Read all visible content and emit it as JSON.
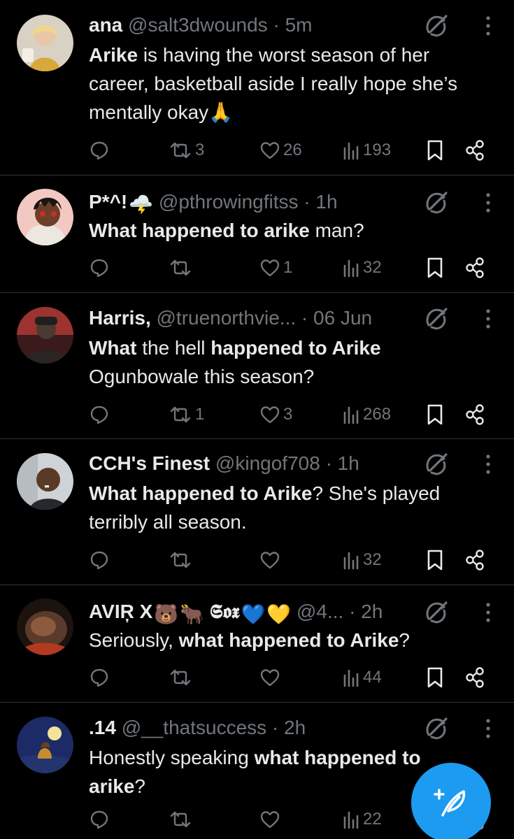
{
  "colors": {
    "background": "#000000",
    "text": "#e7e9ea",
    "muted": "#71767b",
    "divider": "#2f3336",
    "accent": "#1d9bf0"
  },
  "tweets": [
    {
      "name": "ana",
      "handle": "@salt3dwounds",
      "sep": "·",
      "time": "5m",
      "body": [
        {
          "t": "Arike",
          "b": true
        },
        {
          "t": " is having the worst season of her career, basketball aside I really hope she’s mentally okay",
          "b": false
        }
      ],
      "body_emoji": "🙏",
      "name_emojis": [],
      "retweets": "3",
      "likes": "26",
      "views": "193",
      "replies": ""
    },
    {
      "name": "P*^!",
      "handle": "@pthrowingfitss",
      "sep": "·",
      "time": "1h",
      "body": [
        {
          "t": "What happened to arike",
          "b": true
        },
        {
          "t": " man?",
          "b": false
        }
      ],
      "name_emojis": [
        "🌩️"
      ],
      "retweets": "",
      "likes": "1",
      "views": "32",
      "replies": ""
    },
    {
      "name": "Harris,",
      "handle": "@truenorthvie...",
      "sep": "·",
      "time": "06 Jun",
      "body": [
        {
          "t": "What",
          "b": true
        },
        {
          "t": " the hell ",
          "b": false
        },
        {
          "t": "happened to Arike",
          "b": true
        },
        {
          "t": " Ogunbowale this season?",
          "b": false
        }
      ],
      "name_emojis": [],
      "retweets": "1",
      "likes": "3",
      "views": "268",
      "replies": ""
    },
    {
      "name": "CCH's Finest",
      "handle": "@kingof708",
      "sep": "·",
      "time": "1h",
      "body": [
        {
          "t": "What happened to Arike",
          "b": true
        },
        {
          "t": "? She's played terribly all season.",
          "b": false
        }
      ],
      "name_emojis": [],
      "retweets": "",
      "likes": "",
      "views": "32",
      "replies": ""
    },
    {
      "name": "AVIŖ X",
      "name_suffix": "𝕾𝖔𝖝",
      "handle": "@4...",
      "sep": "·",
      "time": "2h",
      "body": [
        {
          "t": "Seriously, ",
          "b": false
        },
        {
          "t": "what happened to Arike",
          "b": true
        },
        {
          "t": "?",
          "b": false
        }
      ],
      "name_emojis": [
        "🐻",
        "🐂"
      ],
      "trailing_emojis": [
        "💙",
        "💛"
      ],
      "retweets": "",
      "likes": "",
      "views": "44",
      "replies": ""
    },
    {
      "name": ".14",
      "handle": "@__thatsuccess",
      "sep": "·",
      "time": "2h",
      "body": [
        {
          "t": "Honestly speaking ",
          "b": false
        },
        {
          "t": "what happened to arike",
          "b": true
        },
        {
          "t": "?",
          "b": false
        }
      ],
      "name_emojis": [],
      "retweets": "",
      "likes": "",
      "views": "22",
      "replies": ""
    }
  ],
  "icons": {
    "reply": "reply-icon",
    "retweet": "retweet-icon",
    "like": "heart-icon",
    "views": "views-chart-icon",
    "bookmark": "bookmark-icon",
    "share": "share-icon",
    "grok": "grok-icon",
    "more": "more-vertical-icon",
    "compose": "compose-feather-icon"
  }
}
